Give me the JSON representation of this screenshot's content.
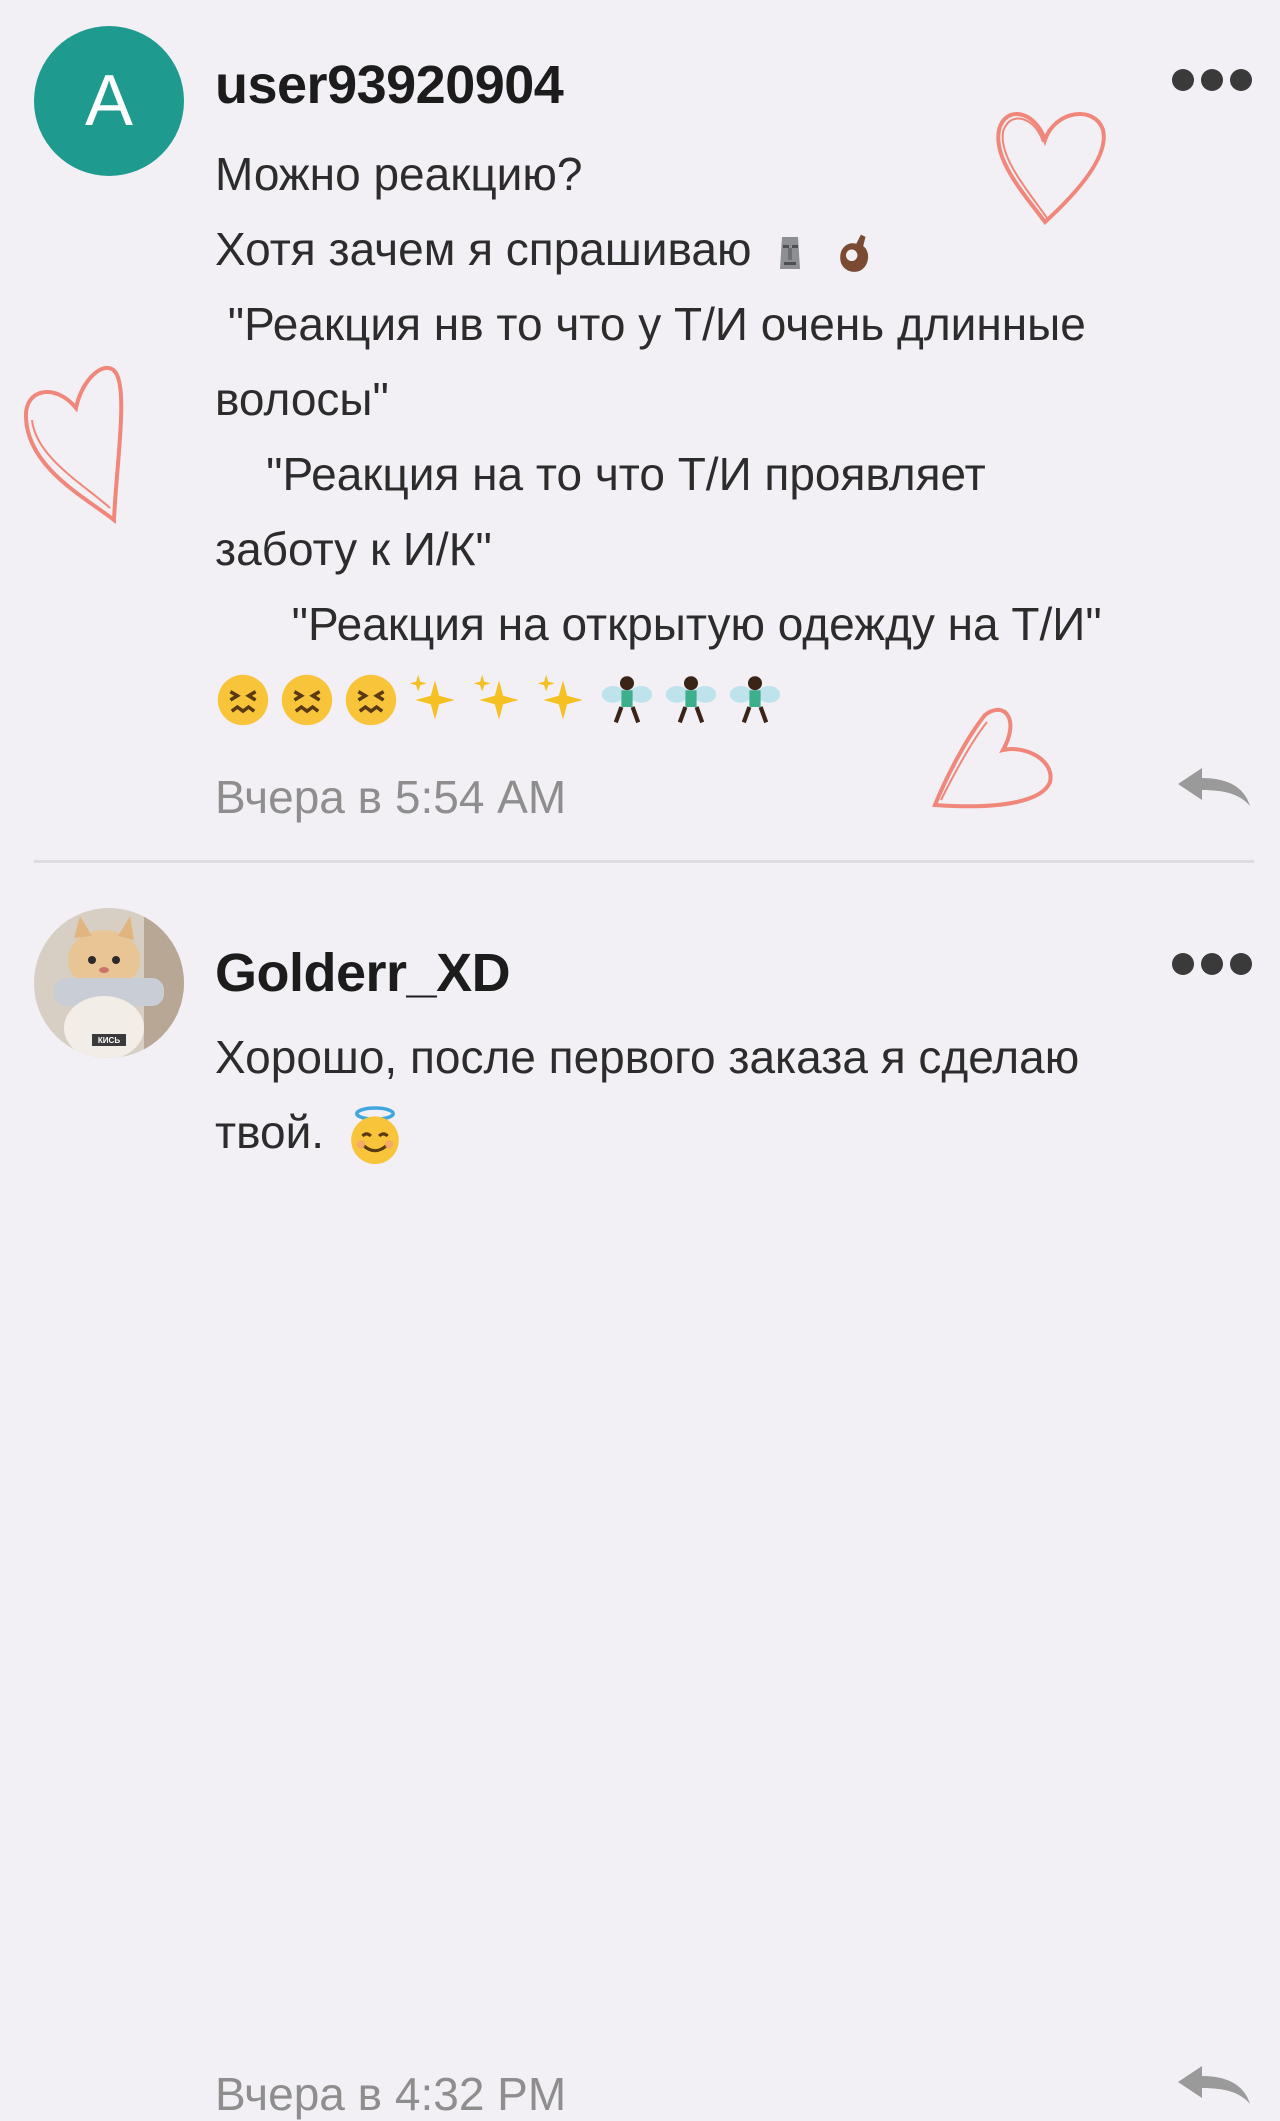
{
  "comments": [
    {
      "avatar_letter": "A",
      "avatar_color": "#1f9a8e",
      "username": "user93920904",
      "lines": [
        "Можно реакцию?",
        "Хотя зачем я спрашиваю",
        " \"Реакция нв то что у Т/И очень длинные",
        "волосы\"",
        "    \"Реакция на то что Т/И проявляет",
        "заботу к И/К\"",
        "      \"Реакция на открытую одежду на Т/И\""
      ],
      "line2_emojis": [
        "moai-emoji",
        "ok-hand-emoji"
      ],
      "emoji_row": [
        "confounded-face",
        "confounded-face",
        "confounded-face",
        "sparkles",
        "sparkles",
        "sparkles",
        "fairy",
        "fairy",
        "fairy"
      ],
      "timestamp": "Вчера в 5:54 AM"
    },
    {
      "avatar_description": "cat-photo",
      "avatar_caption": "КИСЬ",
      "username": "Golderr_XD",
      "lines": [
        "Хорошо, после первого заказа я сделаю",
        "твой."
      ],
      "line2_emojis": [
        "smiling-face-with-halo"
      ],
      "timestamp": "Вчера в 4:32 PM"
    }
  ],
  "icons": [
    "more-options-icon",
    "reply-icon"
  ],
  "colors": {
    "heart": "#f0877a",
    "avatar_teal": "#1f9a8e",
    "background": "#f2f0f4"
  }
}
